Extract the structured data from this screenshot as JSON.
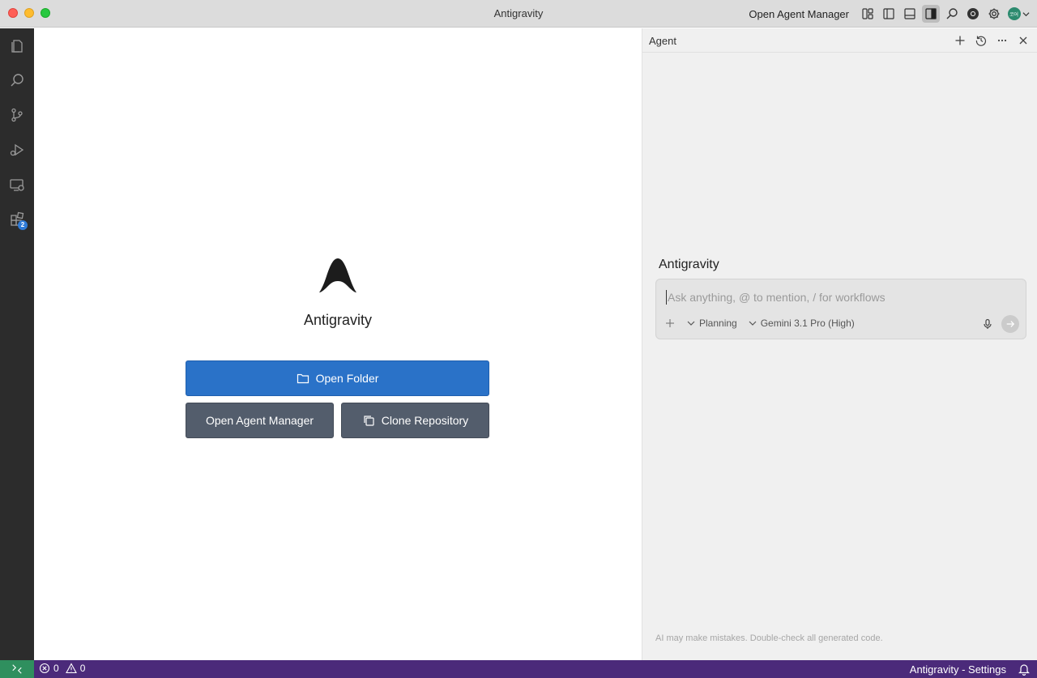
{
  "window": {
    "title": "Antigravity"
  },
  "titlebar": {
    "open_agent_manager": "Open Agent Manager",
    "icons": [
      "layout-icon",
      "toggle-primary-sidebar-icon",
      "toggle-panel-icon",
      "toggle-secondary-sidebar-icon",
      "search-icon",
      "chrome-icon",
      "gear-icon",
      "account-avatar"
    ],
    "avatar_initials": "코어"
  },
  "activity_bar": {
    "items": [
      "explorer-icon",
      "search-icon",
      "source-control-icon",
      "run-debug-icon",
      "remote-explorer-icon",
      "extensions-icon"
    ],
    "extensions_badge": "2"
  },
  "welcome": {
    "title": "Antigravity",
    "open_folder": "Open Folder",
    "open_agent_manager": "Open Agent Manager",
    "clone_repository": "Clone Repository"
  },
  "agent": {
    "header_title": "Agent",
    "heading": "Antigravity",
    "input_placeholder": "Ask anything, @ to mention, / for workflows",
    "mode": "Planning",
    "model": "Gemini 3.1 Pro (High)",
    "disclaimer": "AI may make mistakes. Double-check all generated code."
  },
  "statusbar": {
    "errors": "0",
    "warnings": "0",
    "right_label": "Antigravity - Settings"
  },
  "colors": {
    "primary_button": "#2a72c8",
    "secondary_button": "#535d6c",
    "statusbar": "#4b2a7a",
    "remote_indicator": "#2f8f5e",
    "activity_bar": "#2c2c2c"
  }
}
